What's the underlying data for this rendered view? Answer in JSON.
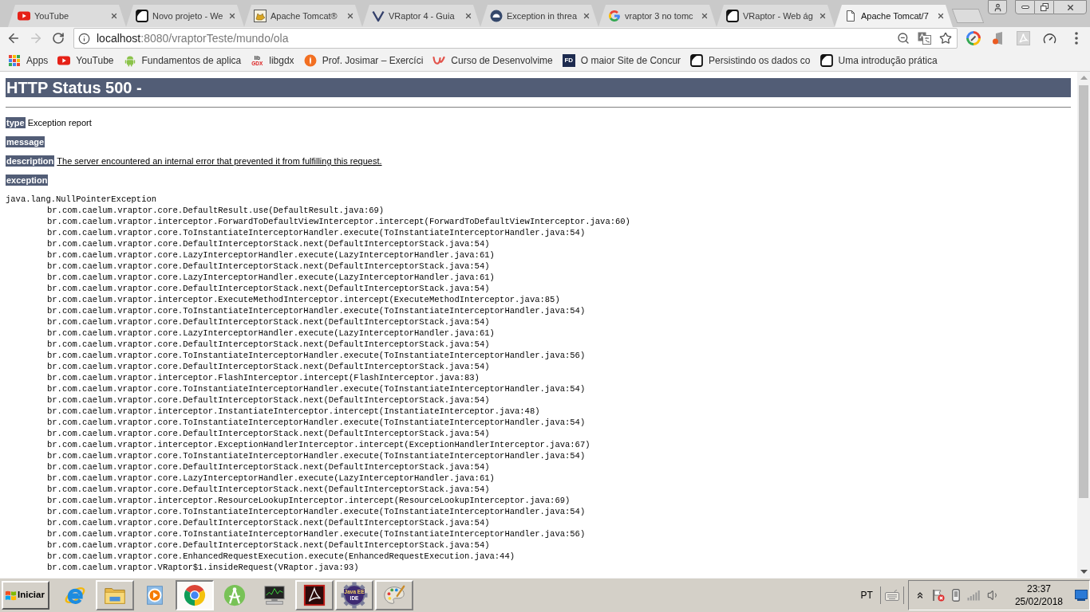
{
  "browser": {
    "tabs": [
      {
        "title": "YouTube",
        "kind": "youtube",
        "selected": false
      },
      {
        "title": "Novo projeto - We",
        "kind": "square",
        "selected": false
      },
      {
        "title": "Apache Tomcat®",
        "kind": "cat",
        "selected": false
      },
      {
        "title": "VRaptor 4 - Guia",
        "kind": "chevron",
        "selected": false
      },
      {
        "title": "Exception in threa",
        "kind": "round",
        "selected": false
      },
      {
        "title": "vraptor 3 no tomc",
        "kind": "ring",
        "selected": false
      },
      {
        "title": "VRaptor - Web ág",
        "kind": "square",
        "selected": false
      },
      {
        "title": "Apache Tomcat/7",
        "kind": "document",
        "selected": true
      }
    ],
    "navigation": {
      "back_disabled": false,
      "forward_disabled": true
    },
    "address": {
      "host": "localhost",
      "path": ":8080/vraptorTeste/mundo/ola"
    },
    "bookmarks": [
      {
        "label": "Apps",
        "kind": "apps"
      },
      {
        "label": "YouTube",
        "kind": "youtube"
      },
      {
        "label": "Fundamentos de aplica",
        "kind": "android"
      },
      {
        "label": "libgdx",
        "kind": "wordmark",
        "logo_lines": [
          "lib",
          "GDX"
        ]
      },
      {
        "label": "Prof. Josimar – Exercíci",
        "kind": "circle"
      },
      {
        "label": "Curso de Desenvolvime",
        "kind": "swoosh"
      },
      {
        "label": "O maior Site de Concur",
        "kind": "tile",
        "logo_text": "FD"
      },
      {
        "label": "Persistindo os dados co",
        "kind": "square"
      },
      {
        "label": "Uma introdução prática",
        "kind": "square"
      }
    ]
  },
  "page": {
    "title": "HTTP Status 500 -",
    "fields": [
      {
        "label": "type",
        "value": "Exception report",
        "underlined": false
      },
      {
        "label": "message"
      },
      {
        "label": "description",
        "value": "The server encountered an internal error that prevented it from fulfilling this request.",
        "underlined": true
      },
      {
        "label": "exception"
      }
    ],
    "exception": {
      "name": "java.lang.NullPointerException",
      "frames": [
        "br.com.caelum.vraptor.core.DefaultResult.use(DefaultResult.java:69)",
        "br.com.caelum.vraptor.interceptor.ForwardToDefaultViewInterceptor.intercept(ForwardToDefaultViewInterceptor.java:60)",
        "br.com.caelum.vraptor.core.ToInstantiateInterceptorHandler.execute(ToInstantiateInterceptorHandler.java:54)",
        "br.com.caelum.vraptor.core.DefaultInterceptorStack.next(DefaultInterceptorStack.java:54)",
        "br.com.caelum.vraptor.core.LazyInterceptorHandler.execute(LazyInterceptorHandler.java:61)",
        "br.com.caelum.vraptor.core.DefaultInterceptorStack.next(DefaultInterceptorStack.java:54)",
        "br.com.caelum.vraptor.core.LazyInterceptorHandler.execute(LazyInterceptorHandler.java:61)",
        "br.com.caelum.vraptor.core.DefaultInterceptorStack.next(DefaultInterceptorStack.java:54)",
        "br.com.caelum.vraptor.interceptor.ExecuteMethodInterceptor.intercept(ExecuteMethodInterceptor.java:85)",
        "br.com.caelum.vraptor.core.ToInstantiateInterceptorHandler.execute(ToInstantiateInterceptorHandler.java:54)",
        "br.com.caelum.vraptor.core.DefaultInterceptorStack.next(DefaultInterceptorStack.java:54)",
        "br.com.caelum.vraptor.core.LazyInterceptorHandler.execute(LazyInterceptorHandler.java:61)",
        "br.com.caelum.vraptor.core.DefaultInterceptorStack.next(DefaultInterceptorStack.java:54)",
        "br.com.caelum.vraptor.core.ToInstantiateInterceptorHandler.execute(ToInstantiateInterceptorHandler.java:56)",
        "br.com.caelum.vraptor.core.DefaultInterceptorStack.next(DefaultInterceptorStack.java:54)",
        "br.com.caelum.vraptor.interceptor.FlashInterceptor.intercept(FlashInterceptor.java:83)",
        "br.com.caelum.vraptor.core.ToInstantiateInterceptorHandler.execute(ToInstantiateInterceptorHandler.java:54)",
        "br.com.caelum.vraptor.core.DefaultInterceptorStack.next(DefaultInterceptorStack.java:54)",
        "br.com.caelum.vraptor.interceptor.InstantiateInterceptor.intercept(InstantiateInterceptor.java:48)",
        "br.com.caelum.vraptor.core.ToInstantiateInterceptorHandler.execute(ToInstantiateInterceptorHandler.java:54)",
        "br.com.caelum.vraptor.core.DefaultInterceptorStack.next(DefaultInterceptorStack.java:54)",
        "br.com.caelum.vraptor.interceptor.ExceptionHandlerInterceptor.intercept(ExceptionHandlerInterceptor.java:67)",
        "br.com.caelum.vraptor.core.ToInstantiateInterceptorHandler.execute(ToInstantiateInterceptorHandler.java:54)",
        "br.com.caelum.vraptor.core.DefaultInterceptorStack.next(DefaultInterceptorStack.java:54)",
        "br.com.caelum.vraptor.core.LazyInterceptorHandler.execute(LazyInterceptorHandler.java:61)",
        "br.com.caelum.vraptor.core.DefaultInterceptorStack.next(DefaultInterceptorStack.java:54)",
        "br.com.caelum.vraptor.interceptor.ResourceLookupInterceptor.intercept(ResourceLookupInterceptor.java:69)",
        "br.com.caelum.vraptor.core.ToInstantiateInterceptorHandler.execute(ToInstantiateInterceptorHandler.java:54)",
        "br.com.caelum.vraptor.core.DefaultInterceptorStack.next(DefaultInterceptorStack.java:54)",
        "br.com.caelum.vraptor.core.ToInstantiateInterceptorHandler.execute(ToInstantiateInterceptorHandler.java:56)",
        "br.com.caelum.vraptor.core.DefaultInterceptorStack.next(DefaultInterceptorStack.java:54)",
        "br.com.caelum.vraptor.core.EnhancedRequestExecution.execute(EnhancedRequestExecution.java:44)",
        "br.com.caelum.vraptor.VRaptor$1.insideRequest(VRaptor.java:93)"
      ]
    }
  },
  "taskbar": {
    "start": "Iniciar",
    "apps": [
      {
        "kind": "ie",
        "running": false,
        "selected": false
      },
      {
        "kind": "folder",
        "running": true,
        "selected": false
      },
      {
        "kind": "media",
        "running": false,
        "selected": false
      },
      {
        "kind": "chrome",
        "running": true,
        "selected": true
      },
      {
        "kind": "android",
        "running": false,
        "selected": false
      },
      {
        "kind": "monitor",
        "running": false,
        "selected": false
      },
      {
        "kind": "pdf",
        "running": true,
        "selected": false
      },
      {
        "kind": "ide",
        "running": true,
        "selected": false,
        "logo_lines": [
          "Java EE",
          "IDE"
        ]
      },
      {
        "kind": "paint",
        "running": true,
        "selected": false
      }
    ],
    "language": "PT",
    "clock": {
      "time": "23:37",
      "date": "25/02/2018"
    }
  }
}
